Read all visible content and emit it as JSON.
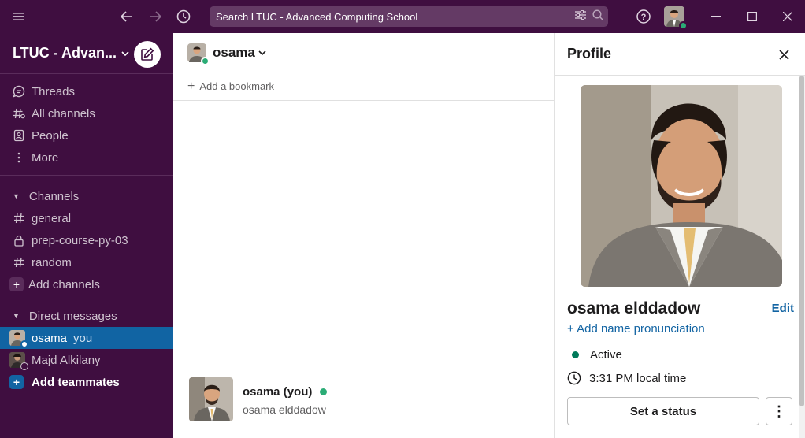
{
  "topbar": {
    "search_placeholder": "Search LTUC - Advanced Computing School"
  },
  "sidebar": {
    "workspace_name": "LTUC - Advan...",
    "nav": [
      {
        "label": "Threads",
        "icon": "threads-icon"
      },
      {
        "label": "All channels",
        "icon": "channels-icon"
      },
      {
        "label": "People",
        "icon": "people-icon"
      },
      {
        "label": "More",
        "icon": "more-vertical-icon"
      }
    ],
    "channels_header": "Channels",
    "channels": [
      {
        "label": "general",
        "icon": "hash-icon"
      },
      {
        "label": "prep-course-py-03",
        "icon": "lock-icon"
      },
      {
        "label": "random",
        "icon": "hash-icon"
      }
    ],
    "add_channels": "Add channels",
    "dm_header": "Direct messages",
    "dms": [
      {
        "label": "osama",
        "tag": "you",
        "active": true,
        "presence": "#2bac76"
      },
      {
        "label": "Majd Alkilany",
        "tag": "",
        "active": false,
        "presence": "#ffffff"
      }
    ],
    "add_teammates": "Add teammates"
  },
  "main": {
    "channel_title": "osama",
    "bookmark": "Add a bookmark",
    "intro_name": "osama (you)",
    "intro_sub": "osama elddadow"
  },
  "profile": {
    "title": "Profile",
    "name": "osama elddadow",
    "edit": "Edit",
    "pronunciation": "Add name pronunciation",
    "status": "Active",
    "local_time": "3:31 PM local time",
    "set_status": "Set a status",
    "more": "⋮"
  },
  "colors": {
    "sidebar_bg": "#3f0e40",
    "active_item": "#1164a3",
    "link": "#1264a3",
    "presence": "#2bac76"
  }
}
